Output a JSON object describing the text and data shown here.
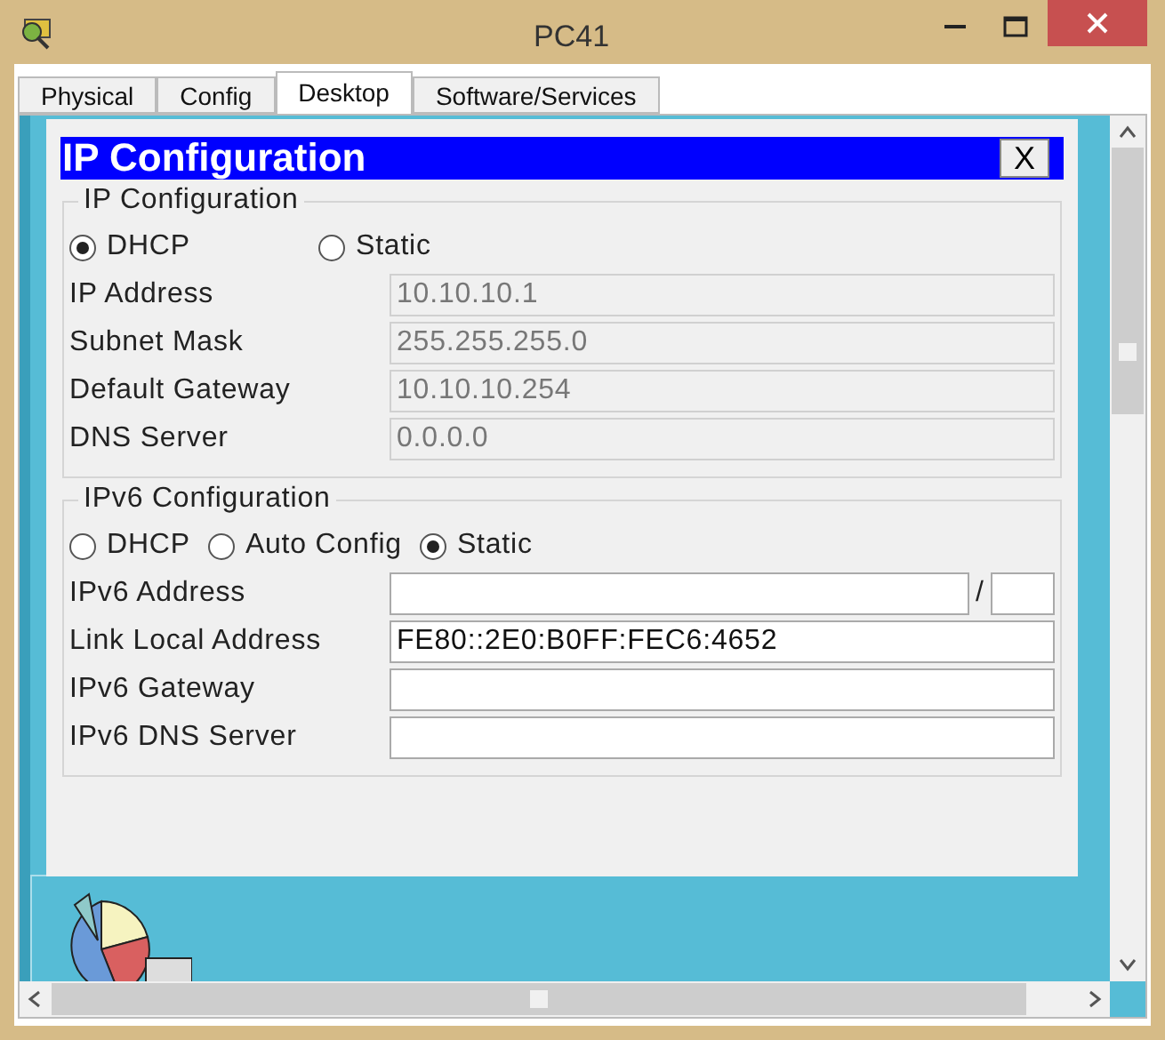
{
  "window": {
    "title": "PC41"
  },
  "tabs": [
    {
      "label": "Physical",
      "selected": false
    },
    {
      "label": "Config",
      "selected": false
    },
    {
      "label": "Desktop",
      "selected": true
    },
    {
      "label": "Software/Services",
      "selected": false
    }
  ],
  "dialog": {
    "title": "IP Configuration",
    "close": "X",
    "sections": [
      {
        "legend": "IP Configuration",
        "modes": [
          {
            "label": "DHCP",
            "selected": true
          },
          {
            "label": "Static",
            "selected": false
          }
        ],
        "fields": [
          {
            "label": "IP Address",
            "value": "10.10.10.1",
            "disabled": true
          },
          {
            "label": "Subnet Mask",
            "value": "255.255.255.0",
            "disabled": true
          },
          {
            "label": "Default Gateway",
            "value": "10.10.10.254",
            "disabled": true
          },
          {
            "label": "DNS Server",
            "value": "0.0.0.0",
            "disabled": true
          }
        ]
      },
      {
        "legend": "IPv6 Configuration",
        "modes": [
          {
            "label": "DHCP",
            "selected": false
          },
          {
            "label": "Auto Config",
            "selected": false
          },
          {
            "label": "Static",
            "selected": true
          }
        ],
        "fields": [
          {
            "label": "IPv6 Address",
            "disabled": false,
            "kind": "prefixed",
            "separator": "/"
          },
          {
            "label": "Link Local Address",
            "value": "FE80::2E0:B0FF:FEC6:4652",
            "disabled": false
          },
          {
            "label": "IPv6 Gateway",
            "disabled": false
          },
          {
            "label": "IPv6 DNS Server",
            "disabled": false
          }
        ]
      }
    ]
  }
}
